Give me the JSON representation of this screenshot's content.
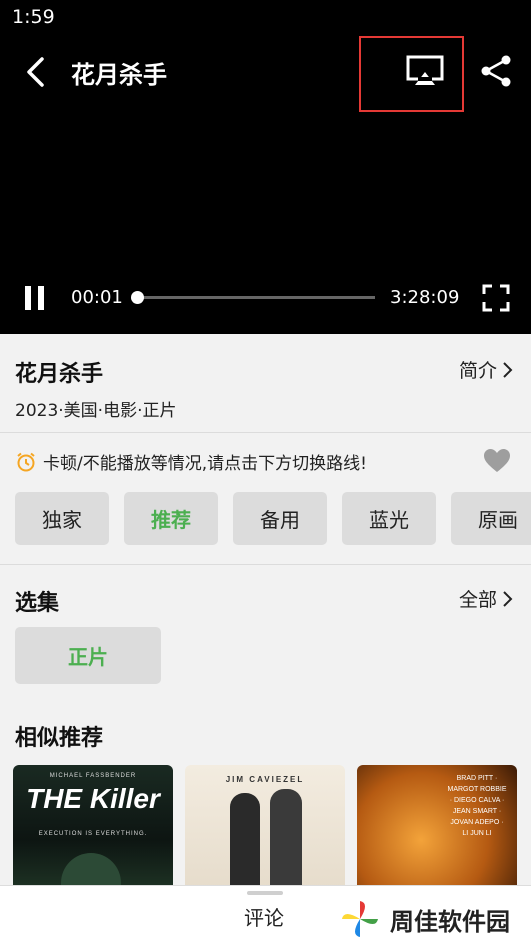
{
  "status": {
    "time": "1:59"
  },
  "player": {
    "title": "花月杀手",
    "current_time": "00:01",
    "duration": "3:28:09",
    "progress_fraction": 0.0
  },
  "info": {
    "movie_name": "花月杀手",
    "meta": "2023·美国·电影·正片",
    "intro_label": "简介"
  },
  "notice": {
    "text": "卡顿/不能播放等情况,请点击下方切换路线!"
  },
  "lines": [
    {
      "label": "独家",
      "active": false
    },
    {
      "label": "推荐",
      "active": true
    },
    {
      "label": "备用",
      "active": false
    },
    {
      "label": "蓝光",
      "active": false
    },
    {
      "label": "原画",
      "active": false
    }
  ],
  "episodes": {
    "title": "选集",
    "all_label": "全部",
    "items": [
      {
        "label": "正片",
        "active": true
      }
    ]
  },
  "similar": {
    "title": "相似推荐",
    "posters": [
      {
        "top": "MICHAEL FASSBENDER",
        "main": "THE Killer",
        "sub": "EXECUTION IS EVERYTHING."
      },
      {
        "top": "JIM CAVIEZEL",
        "main": "",
        "sub": ""
      },
      {
        "top": "BRAD PITT · MARGOT ROBBIE · DIEGO CALVA · JEAN SMART · JOVAN ADEPO · LI JUN LI",
        "main": "",
        "sub": ""
      }
    ]
  },
  "bottom": {
    "comment_label": "评论"
  },
  "watermark": {
    "text": "周佳软件园"
  },
  "colors": {
    "accent_green": "#4caf50",
    "highlight_red": "#e53935",
    "alarm_orange": "#f5a623"
  }
}
